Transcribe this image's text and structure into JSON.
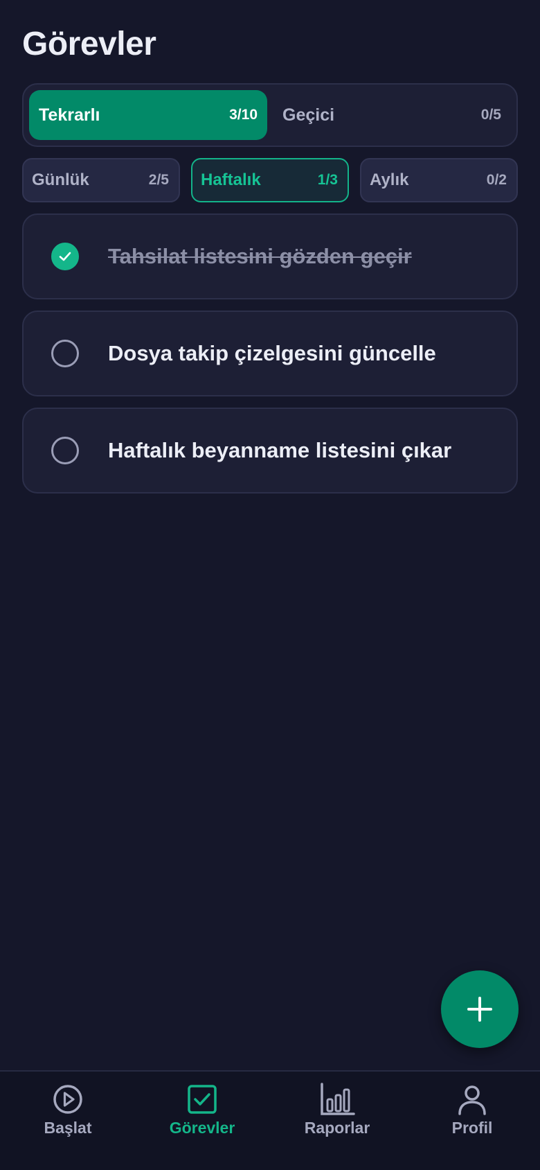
{
  "header": {
    "title": "Görevler"
  },
  "segments": [
    {
      "label": "Tekrarlı",
      "count": "3/10",
      "active": true
    },
    {
      "label": "Geçici",
      "count": "0/5",
      "active": false
    }
  ],
  "periods": [
    {
      "label": "Günlük",
      "count": "2/5",
      "active": false
    },
    {
      "label": "Haftalık",
      "count": "1/3",
      "active": true
    },
    {
      "label": "Aylık",
      "count": "0/2",
      "active": false
    }
  ],
  "tasks": [
    {
      "text": "Tahsilat listesini gözden geçir",
      "done": true
    },
    {
      "text": "Dosya takip çizelgesini güncelle",
      "done": false
    },
    {
      "text": "Haftalık beyanname listesini çıkar",
      "done": false
    }
  ],
  "fab": {
    "icon": "plus-icon"
  },
  "tabbar": {
    "items": [
      {
        "label": "Başlat",
        "icon": "play-circle-icon",
        "active": false
      },
      {
        "label": "Görevler",
        "icon": "checkbox-icon",
        "active": true
      },
      {
        "label": "Raporlar",
        "icon": "bar-chart-icon",
        "active": false
      },
      {
        "label": "Profil",
        "icon": "person-icon",
        "active": false
      }
    ]
  },
  "colors": {
    "background": "#15172a",
    "accent": "#028a68",
    "accent_bright": "#14b68a",
    "card": "#1d1f35"
  }
}
